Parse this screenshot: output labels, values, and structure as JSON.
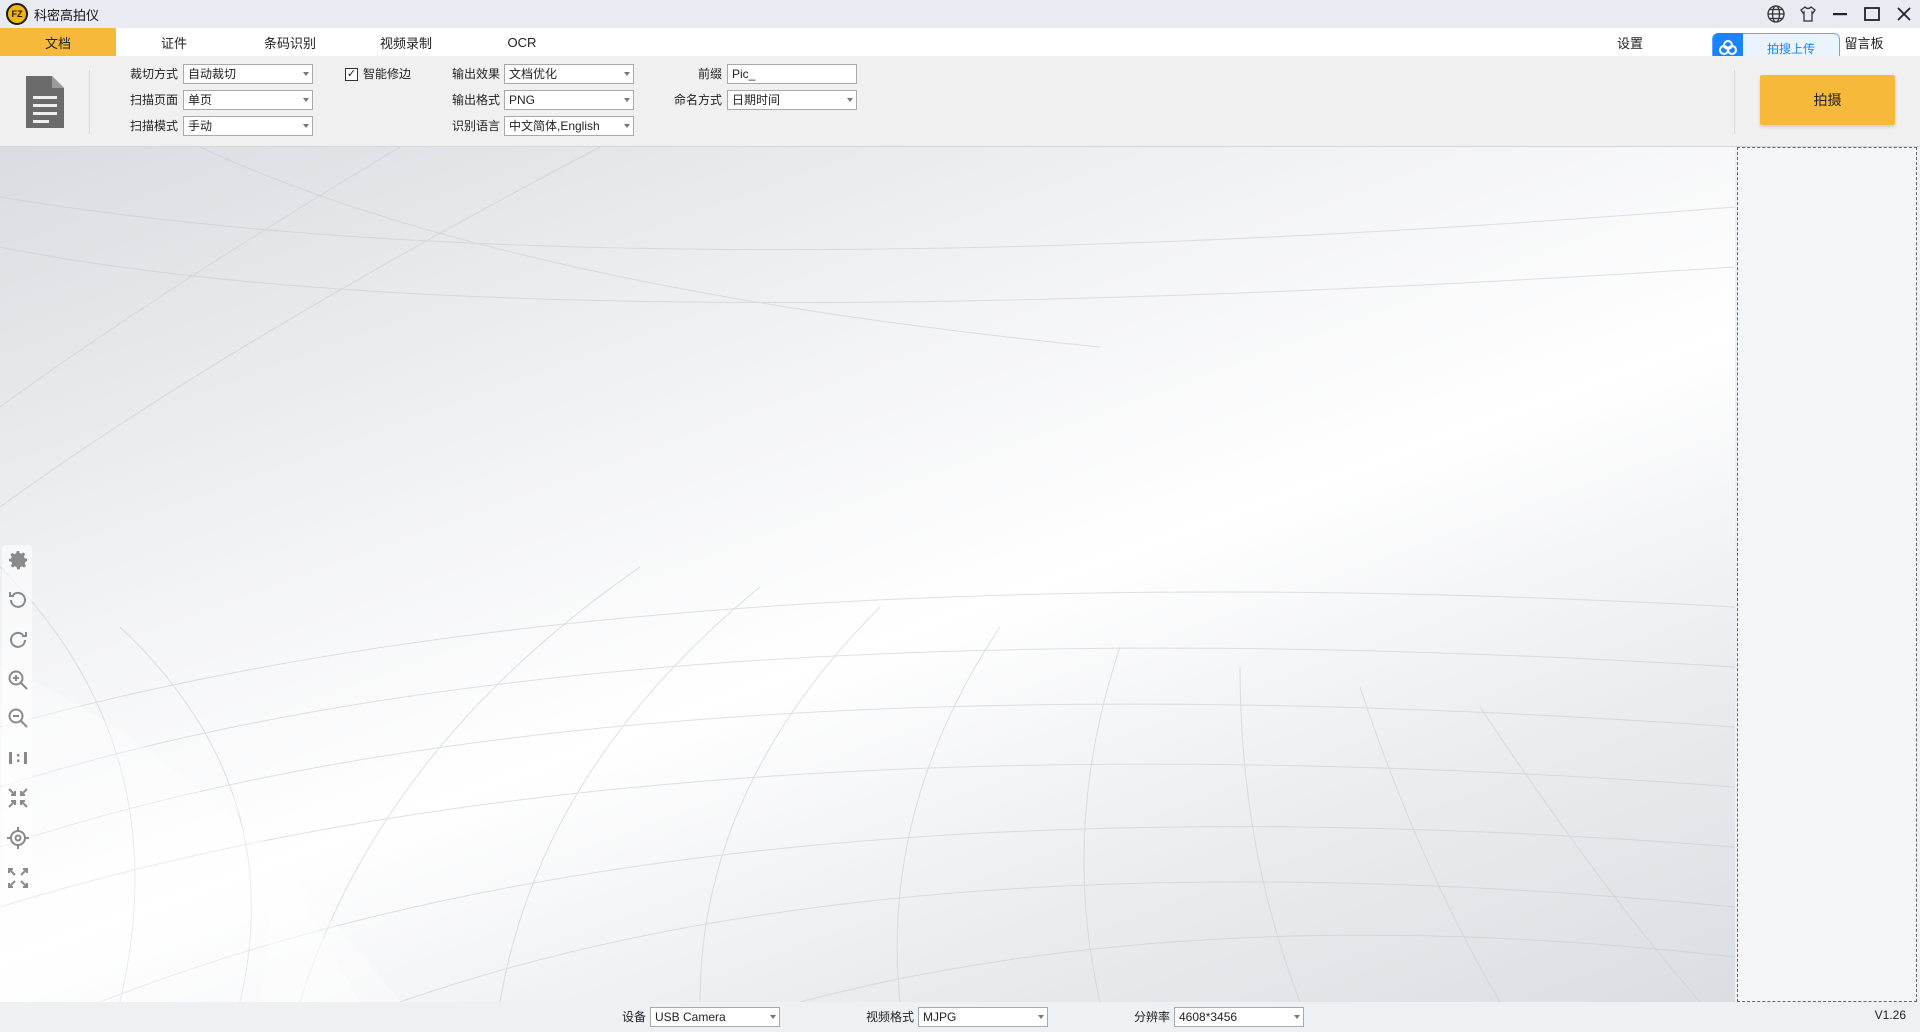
{
  "window": {
    "title": "科密高拍仪",
    "logo_text": "FZ"
  },
  "tabs": [
    {
      "label": "文档",
      "active": true
    },
    {
      "label": "证件"
    },
    {
      "label": "条码识别"
    },
    {
      "label": "视频录制"
    },
    {
      "label": "OCR"
    },
    {
      "label": "设置"
    },
    {
      "label": "留言板"
    }
  ],
  "upload": {
    "label": "拍搜上传"
  },
  "toolbar": {
    "crop_label": "裁切方式",
    "crop_value": "自动裁切",
    "page_label": "扫描页面",
    "page_value": "单页",
    "mode_label": "扫描模式",
    "mode_value": "手动",
    "smart_edge_label": "智能修边",
    "smart_edge_checked": "✓",
    "effect_label": "输出效果",
    "effect_value": "文档优化",
    "format_label": "输出格式",
    "format_value": "PNG",
    "lang_label": "识别语言",
    "lang_value": "中文简体,English",
    "prefix_label": "前缀",
    "prefix_value": "Pic_",
    "naming_label": "命名方式",
    "naming_value": "日期时间",
    "capture_label": "拍摄"
  },
  "statusbar": {
    "device_label": "设备",
    "device_value": "USB Camera",
    "video_format_label": "视频格式",
    "video_format_value": "MJPG",
    "resolution_label": "分辨率",
    "resolution_value": "4608*3456",
    "version": "V1.26"
  },
  "side_tools": [
    "gear-icon",
    "rotate-left-icon",
    "rotate-right-icon",
    "zoom-in-icon",
    "zoom-out-icon",
    "actual-size-icon",
    "fit-window-icon",
    "crosshair-icon",
    "fullscreen-icon"
  ],
  "colors": {
    "accent": "#f7b93a",
    "upload_blue": "#1a84ff"
  }
}
